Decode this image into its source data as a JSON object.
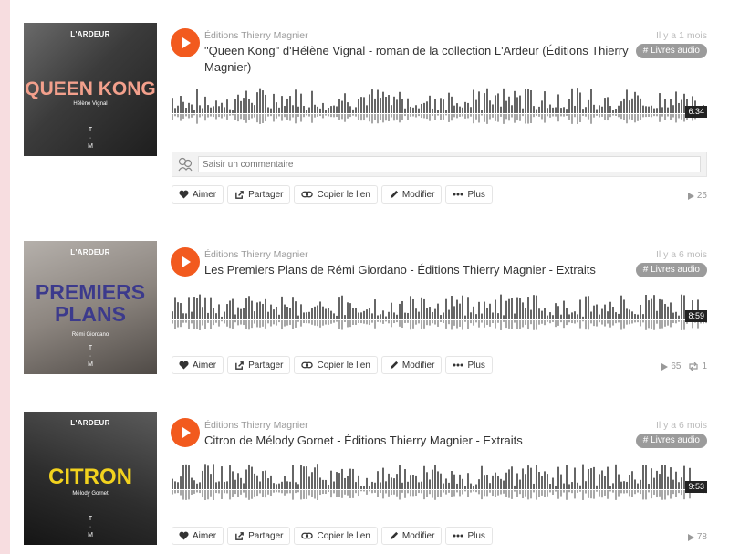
{
  "colors": {
    "accent": "#f25a1e",
    "tag": "#9b9b9b",
    "wave_played": "#666666",
    "wave_unplayed": "#a8a8a8"
  },
  "comment_placeholder": "Saisir un commentaire",
  "actions": {
    "like": "Aimer",
    "share": "Partager",
    "copy_link": "Copier le lien",
    "edit": "Modifier",
    "more": "Plus"
  },
  "tracks": [
    {
      "artist": "Éditions Thierry Magnier",
      "title": "\"Queen Kong\" d'Hélène Vignal - roman de la collection L'Ardeur (Éditions Thierry Magnier)",
      "date": "Il y a 1 mois",
      "tag": "# Livres audio",
      "duration": "6:34",
      "plays": "25",
      "reposts": "",
      "cover": {
        "label": "L'ARDEUR",
        "title": "QUEEN KONG",
        "author": "Hélène Vignal",
        "logo": "T\n·\nM",
        "title_color": "#f3a08c"
      }
    },
    {
      "artist": "Éditions Thierry Magnier",
      "title": "Les Premiers Plans de Rémi Giordano - Éditions Thierry Magnier - Extraits",
      "date": "Il y a 6 mois",
      "tag": "# Livres audio",
      "duration": "8:59",
      "plays": "65",
      "reposts": "1",
      "cover": {
        "label": "L'ARDEUR",
        "title": "PREMIERS PLANS",
        "author": "Rémi Giordano",
        "logo": "T\n·\nM",
        "title_color": "#3c3a8c"
      }
    },
    {
      "artist": "Éditions Thierry Magnier",
      "title": "Citron de Mélody Gornet - Éditions Thierry Magnier - Extraits",
      "date": "Il y a 6 mois",
      "tag": "# Livres audio",
      "duration": "9:53",
      "plays": "78",
      "reposts": "",
      "cover": {
        "label": "L'ARDEUR",
        "title": "CITRON",
        "author": "Mélody Gornet",
        "logo": "T\n·\nM",
        "title_color": "#f2d21e"
      }
    }
  ]
}
